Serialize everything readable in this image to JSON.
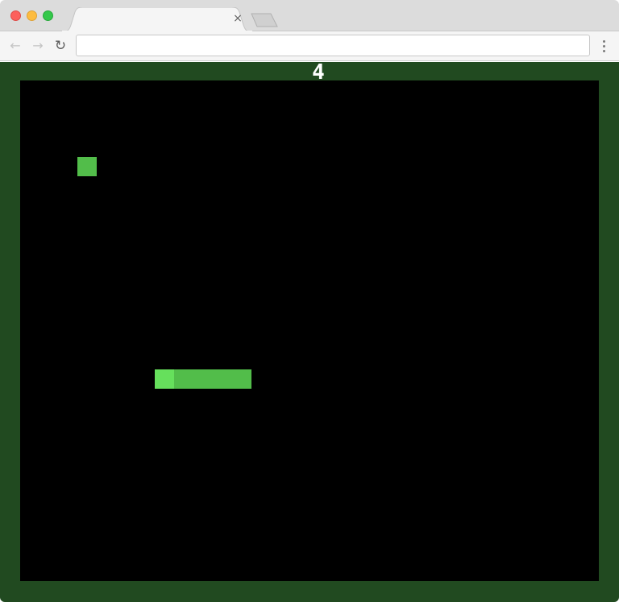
{
  "browser": {
    "tab_close_glyph": "×",
    "address_value": "",
    "nav_back_glyph": "←",
    "nav_forward_glyph": "→",
    "nav_reload_glyph": "↻"
  },
  "game": {
    "score": "4",
    "grid": {
      "cols": 30,
      "rows": 26
    },
    "food": {
      "col": 3,
      "row": 4
    },
    "snake": [
      {
        "col": 7,
        "row": 15,
        "head": true
      },
      {
        "col": 8,
        "row": 15
      },
      {
        "col": 9,
        "row": 15
      },
      {
        "col": 10,
        "row": 15
      },
      {
        "col": 11,
        "row": 15
      }
    ],
    "colors": {
      "border": "#214a20",
      "board": "#000000",
      "snake_head": "#66e05c",
      "snake_body": "#52bd4a",
      "food": "#52bd4a",
      "score_text": "#ffffff"
    }
  }
}
